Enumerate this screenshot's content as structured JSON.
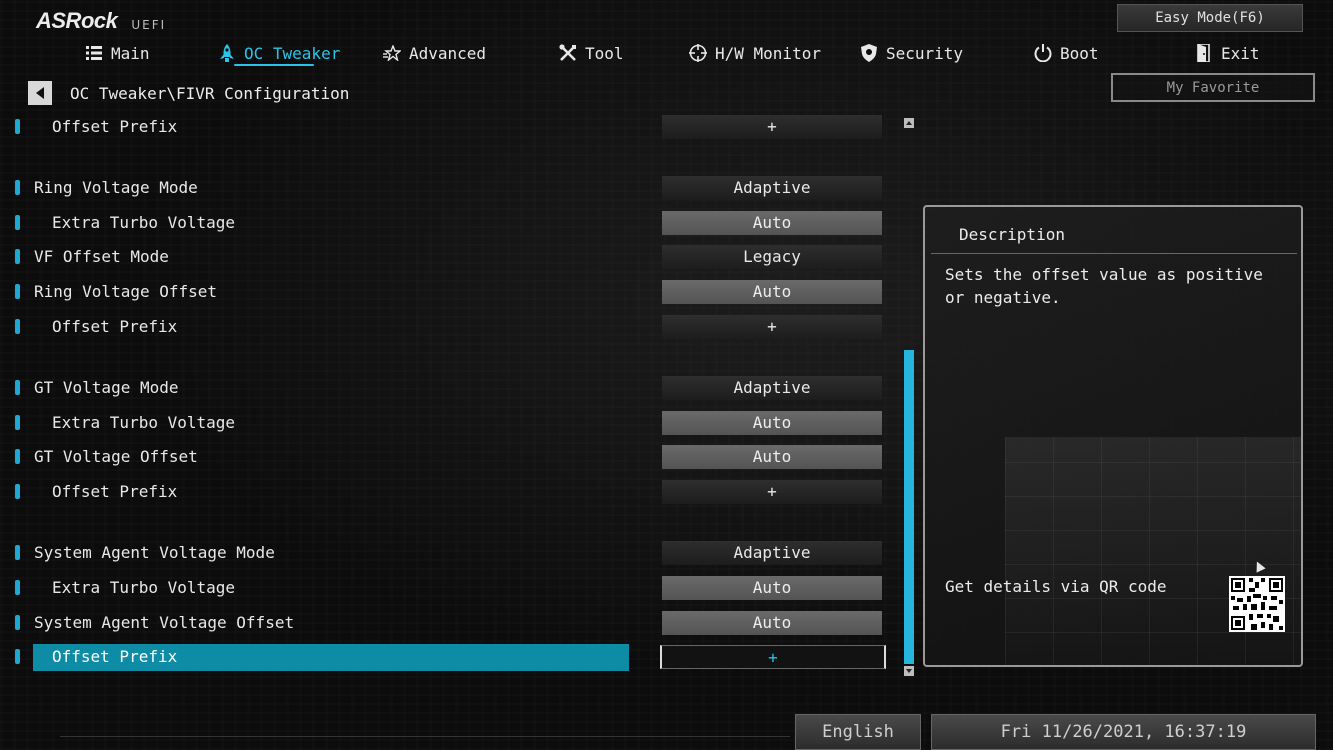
{
  "brand": {
    "name": "ASRock",
    "suffix": "UEFI"
  },
  "easy_mode_label": "Easy Mode(F6)",
  "nav": [
    {
      "label": "Main",
      "icon": "list-icon"
    },
    {
      "label": "OC Tweaker",
      "icon": "rocket-icon",
      "active": true
    },
    {
      "label": "Advanced",
      "icon": "star-icon"
    },
    {
      "label": "Tool",
      "icon": "tools-icon"
    },
    {
      "label": "H/W Monitor",
      "icon": "crosshair-icon"
    },
    {
      "label": "Security",
      "icon": "shield-icon"
    },
    {
      "label": "Boot",
      "icon": "power-icon"
    },
    {
      "label": "Exit",
      "icon": "door-icon"
    }
  ],
  "breadcrumb": "OC Tweaker\\FIVR Configuration",
  "my_favorite_label": "My Favorite",
  "settings": [
    {
      "label": "Offset Prefix",
      "value": "+",
      "indent": true,
      "style": "dark"
    },
    {
      "label": "Ring Voltage Mode",
      "value": "Adaptive",
      "indent": false,
      "style": "dark"
    },
    {
      "label": "Extra Turbo Voltage",
      "value": "Auto",
      "indent": true,
      "style": "light"
    },
    {
      "label": "VF Offset Mode",
      "value": "Legacy",
      "indent": false,
      "style": "dark"
    },
    {
      "label": "Ring Voltage Offset",
      "value": "Auto",
      "indent": false,
      "style": "light"
    },
    {
      "label": "Offset Prefix",
      "value": "+",
      "indent": true,
      "style": "dark"
    },
    {
      "label": "GT Voltage Mode",
      "value": "Adaptive",
      "indent": false,
      "style": "dark"
    },
    {
      "label": "Extra Turbo Voltage",
      "value": "Auto",
      "indent": true,
      "style": "light"
    },
    {
      "label": "GT Voltage Offset",
      "value": "Auto",
      "indent": false,
      "style": "light"
    },
    {
      "label": "Offset Prefix",
      "value": "+",
      "indent": true,
      "style": "dark"
    },
    {
      "label": "System Agent Voltage Mode",
      "value": "Adaptive",
      "indent": false,
      "style": "dark"
    },
    {
      "label": "Extra Turbo Voltage",
      "value": "Auto",
      "indent": true,
      "style": "light"
    },
    {
      "label": "System Agent Voltage Offset",
      "value": "Auto",
      "indent": false,
      "style": "light"
    },
    {
      "label": "Offset Prefix",
      "value": "+",
      "indent": true,
      "style": "selected",
      "selected": true
    }
  ],
  "description": {
    "title": "Description",
    "text": "Sets the offset value as positive or negative.",
    "qr_text": "Get details via QR code"
  },
  "footer": {
    "language": "English",
    "datetime": "Fri 11/26/2021, 16:37:19"
  },
  "colors": {
    "accent": "#29c4e8",
    "selection": "#0e8ca6",
    "scrollbar": "#24b6dd"
  }
}
